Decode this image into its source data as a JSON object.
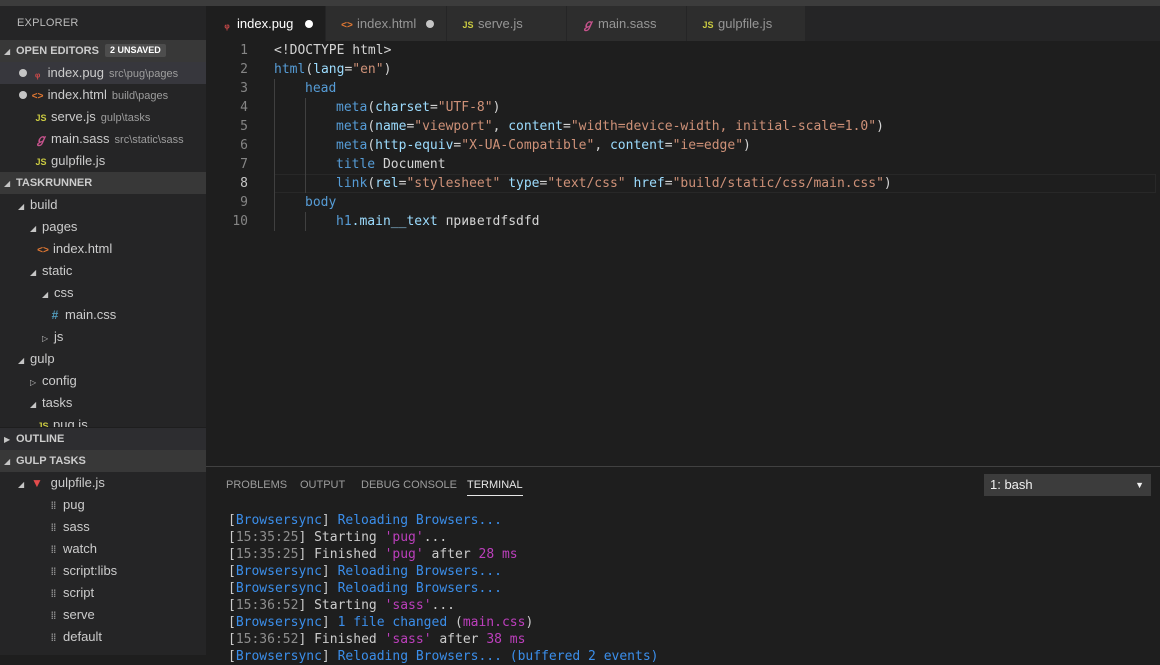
{
  "explorer": {
    "title": "EXPLORER",
    "open_editors": {
      "label": "OPEN EDITORS",
      "badge": "2 UNSAVED",
      "items": [
        {
          "name": "index.pug",
          "path": "src\\pug\\pages"
        },
        {
          "name": "index.html",
          "path": "build\\pages"
        },
        {
          "name": "serve.js",
          "path": "gulp\\tasks"
        },
        {
          "name": "main.sass",
          "path": "src\\static\\sass"
        },
        {
          "name": "gulpfile.js",
          "path": ""
        }
      ]
    },
    "taskrunner": {
      "label": "TASKRUNNER",
      "tree": [
        "build",
        "pages",
        "index.html",
        "static",
        "css",
        "main.css",
        "js",
        "gulp",
        "config",
        "tasks",
        "pug.js"
      ]
    },
    "outline": {
      "label": "OUTLINE"
    },
    "gulp_tasks": {
      "label": "GULP TASKS",
      "file": "gulpfile.js",
      "tasks": [
        "pug",
        "sass",
        "watch",
        "script:libs",
        "script",
        "serve",
        "default"
      ]
    }
  },
  "tabs": [
    {
      "label": "index.pug"
    },
    {
      "label": "index.html"
    },
    {
      "label": "serve.js"
    },
    {
      "label": "main.sass"
    },
    {
      "label": "gulpfile.js"
    }
  ],
  "icons": {
    "js": "JS",
    "html": "<>",
    "css": "#",
    "grip": "⁞⁞"
  },
  "editor": {
    "line_numbers": [
      "1",
      "2",
      "3",
      "4",
      "5",
      "6",
      "7",
      "8",
      "9",
      "10"
    ],
    "current_line": "8",
    "code": {
      "l1": "<!DOCTYPE html>",
      "l2_tag": "html",
      "l2_attr": "lang",
      "l2_val": "\"en\"",
      "l3": "head",
      "l4_tag": "meta",
      "l4_attr": "charset",
      "l4_val": "\"UTF-8\"",
      "l5_tag": "meta",
      "l5_attr1": "name",
      "l5_val1": "\"viewport\"",
      "l5_attr2": "content",
      "l5_val2": "\"width=device-width, initial-scale=1.0\"",
      "l6_tag": "meta",
      "l6_attr1": "http-equiv",
      "l6_val1": "\"X-UA-Compatible\"",
      "l6_attr2": "content",
      "l6_val2": "\"ie=edge\"",
      "l7_tag": "title",
      "l7_text": "Document",
      "l8_tag": "link",
      "l8_attr1": "rel",
      "l8_val1": "\"stylesheet\"",
      "l8_attr2": "type",
      "l8_val2": "\"text/css\"",
      "l8_attr3": "href",
      "l8_val3": "\"build/static/css/main.css\"",
      "l9": "body",
      "l10_tag": "h1",
      "l10_class": ".main__text",
      "l10_text": "приветdfsdfd"
    }
  },
  "panel": {
    "tabs": [
      "PROBLEMS",
      "OUTPUT",
      "DEBUG CONSOLE",
      "TERMINAL"
    ],
    "terminal_select": "1: bash",
    "terminal": {
      "bs": "Browsersync",
      "reloading": "Reloading Browsers...",
      "t1": "15:35:25",
      "t2": "15:35:25",
      "t3": "15:36:52",
      "t4": "15:36:52",
      "starting": "Starting",
      "finished": "Finished",
      "pug": "'pug'",
      "sass": "'sass'",
      "dots": "...",
      "after": "after",
      "ms28": "28 ms",
      "ms38": "38 ms",
      "file_changed": "1 file changed",
      "main_css": "main.css",
      "buffered": "(buffered 2 events)"
    }
  }
}
